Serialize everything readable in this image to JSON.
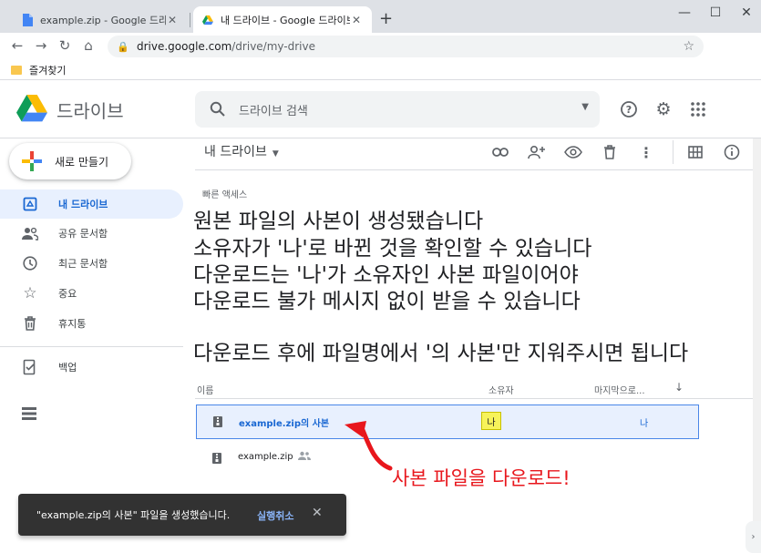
{
  "browser": {
    "tabs": [
      {
        "title": "example.zip - Google 드라이브",
        "active": false
      },
      {
        "title": "내 드라이브 - Google 드라이브",
        "active": true
      }
    ],
    "new_tab": "+",
    "url_host": "drive.google.com",
    "url_path": "/drive/my-drive",
    "bookmark_folder": "즐겨찾기"
  },
  "header": {
    "brand": "드라이브",
    "search_placeholder": "드라이브 검색"
  },
  "sidebar": {
    "new_button": "새로 만들기",
    "items": [
      {
        "label": "내 드라이브",
        "icon": "drive-icon",
        "active": true
      },
      {
        "label": "공유 문서함",
        "icon": "people-icon",
        "active": false
      },
      {
        "label": "최근 문서함",
        "icon": "clock-icon",
        "active": false
      },
      {
        "label": "중요",
        "icon": "star-icon",
        "active": false
      },
      {
        "label": "휴지통",
        "icon": "trash-icon",
        "active": false
      },
      {
        "label": "백업",
        "icon": "backup-icon",
        "active": false
      }
    ]
  },
  "main": {
    "breadcrumb": "내 드라이브",
    "quick_access": "빠른 액세스",
    "annotation_lines": [
      "원본 파일의 사본이 생성됐습니다",
      "소유자가 '나'로 바뀐 것을 확인할 수 있습니다",
      "다운로드는 '나'가 소유자인 사본 파일이어야",
      "다운로드 불가 메시지 없이 받을 수 있습니다",
      "다운로드 후에 파일명에서 '의 사본'만 지워주시면 됩니다"
    ],
    "columns": {
      "name": "이름",
      "owner": "소유자",
      "modified": "마지막으로...",
      "sort": "↓"
    },
    "files": [
      {
        "name": "example.zip의 사본",
        "owner": "나",
        "modified": "나",
        "selected": true
      },
      {
        "name": "example.zip",
        "shared": true,
        "selected": false
      }
    ],
    "red_label": "사본 파일을 다운로드!"
  },
  "toast": {
    "message": "\"example.zip의 사본\" 파일을 생성했습니다.",
    "undo": "실행취소",
    "close": "✕"
  },
  "colors": {
    "accent": "#1967d2",
    "selected_bg": "#e8f0fe",
    "highlight": "#f7f35a",
    "annotation_red": "#e8161c"
  }
}
